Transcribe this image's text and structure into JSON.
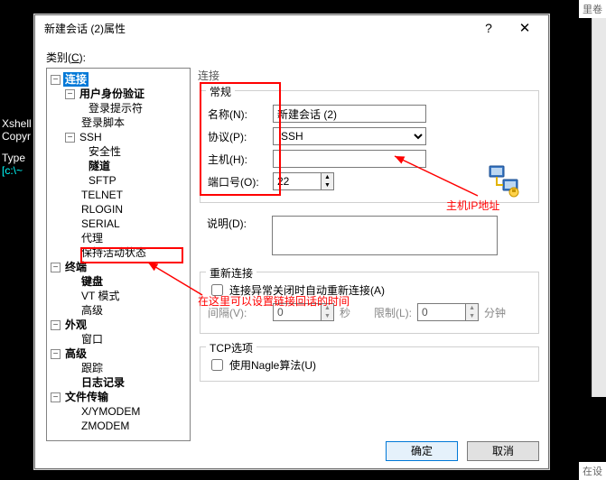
{
  "corner_top": "里卷",
  "corner_bottom": "在设",
  "side": {
    "l1": "Xshell",
    "l2": "Copyr",
    "l3": "Type",
    "l4": "[c:\\~"
  },
  "dialog": {
    "title": "新建会话 (2)属性",
    "category_label_pre": "类别(",
    "category_label_u": "C",
    "category_label_post": "):",
    "ok": "确定",
    "cancel": "取消"
  },
  "tree": {
    "conn": "连接",
    "auth": "用户身份验证",
    "login_prompt": "登录提示符",
    "login_script": "登录脚本",
    "ssh": "SSH",
    "security": "安全性",
    "tunnel": "隧道",
    "sftp": "SFTP",
    "telnet": "TELNET",
    "rlogin": "RLOGIN",
    "serial": "SERIAL",
    "proxy": "代理",
    "keepalive": "保持活动状态",
    "terminal": "终端",
    "keyboard": "键盘",
    "vt": "VT 模式",
    "advanced": "高级",
    "appearance": "外观",
    "window": "窗口",
    "advanced2": "高级",
    "trace": "跟踪",
    "logging": "日志记录",
    "filetransfer": "文件传输",
    "xymodem": "X/YMODEM",
    "zmodem": "ZMODEM"
  },
  "right": {
    "heading": "连接",
    "general": "常规",
    "name_label": "名称(N):",
    "name_value": "新建会话 (2)",
    "proto_label": "协议(P):",
    "proto_value": "SSH",
    "host_label": "主机(H):",
    "host_value": "",
    "port_label": "端口号(O):",
    "port_value": "22",
    "desc_label": "说明(D):",
    "desc_value": "",
    "reconnect_group": "重新连接",
    "reconnect_chk": "连接异常关闭时自动重新连接(A)",
    "interval_label": "间隔(V):",
    "interval_value": "0",
    "sec": "秒",
    "limit_label": "限制(L):",
    "limit_value": "0",
    "min": "分钟",
    "tcp_group": "TCP选项",
    "nagle_chk": "使用Nagle算法(U)"
  },
  "annotations": {
    "host_ip": "主机IP地址",
    "keepalive_note": "在这里可以设置链接回话的时间"
  }
}
